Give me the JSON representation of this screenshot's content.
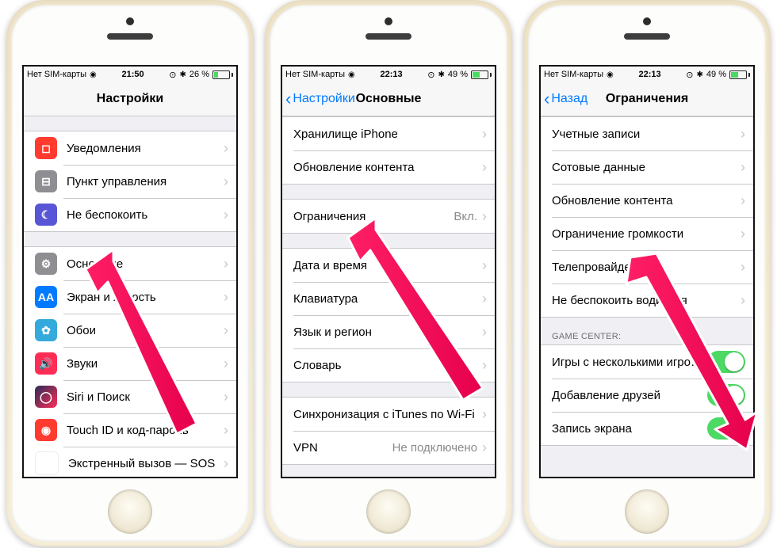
{
  "status": {
    "carrier": "Нет SIM-карты",
    "time1": "21:50",
    "time2": "22:13",
    "time3": "22:13",
    "pct1": "26 %",
    "pct2": "49 %",
    "pct3": "49 %"
  },
  "screen1": {
    "title": "Настройки",
    "group1": [
      {
        "label": "Уведомления"
      },
      {
        "label": "Пункт управления"
      },
      {
        "label": "Не беспокоить"
      }
    ],
    "group2": [
      {
        "label": "Основные"
      },
      {
        "label": "Экран и яркость"
      },
      {
        "label": "Обои"
      },
      {
        "label": "Звуки"
      },
      {
        "label": "Siri и Поиск"
      },
      {
        "label": "Touch ID и код-пароль"
      },
      {
        "label": "Экстренный вызов — SOS"
      }
    ]
  },
  "screen2": {
    "back": "Настройки",
    "title": "Основные",
    "group1": [
      {
        "label": "Хранилище iPhone"
      },
      {
        "label": "Обновление контента"
      }
    ],
    "group2": [
      {
        "label": "Ограничения",
        "value": "Вкл."
      }
    ],
    "group3": [
      {
        "label": "Дата и время"
      },
      {
        "label": "Клавиатура"
      },
      {
        "label": "Язык и регион"
      },
      {
        "label": "Словарь"
      }
    ],
    "group4": [
      {
        "label": "Синхронизация с iTunes по Wi-Fi"
      },
      {
        "label": "VPN",
        "value": "Не подключено"
      }
    ]
  },
  "screen3": {
    "back": "Назад",
    "title": "Ограничения",
    "group1": [
      {
        "label": "Учетные записи"
      },
      {
        "label": "Сотовые данные"
      },
      {
        "label": "Обновление контента"
      },
      {
        "label": "Ограничение громкости"
      },
      {
        "label": "Телепровайдер"
      },
      {
        "label": "Не беспокоить водителя"
      }
    ],
    "gcHeader": "GAME CENTER:",
    "group2": [
      {
        "label": "Игры с несколькими игрока...",
        "on": true
      },
      {
        "label": "Добавление друзей",
        "on": true
      },
      {
        "label": "Запись экрана",
        "on": true
      }
    ]
  }
}
